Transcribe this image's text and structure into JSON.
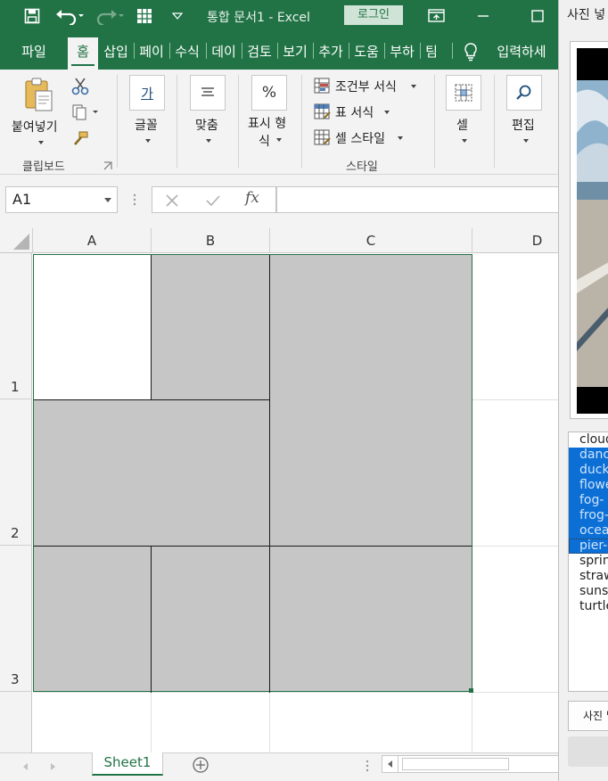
{
  "app": {
    "title": "통합 문서1 - Excel",
    "login_label": "로그인"
  },
  "tabs": [
    {
      "label": "파일"
    },
    {
      "label": "홈"
    },
    {
      "label": "삽입"
    },
    {
      "label": "페이"
    },
    {
      "label": "수식"
    },
    {
      "label": "데이"
    },
    {
      "label": "검토"
    },
    {
      "label": "보기"
    },
    {
      "label": "추가"
    },
    {
      "label": "도움"
    },
    {
      "label": "부하"
    },
    {
      "label": "팀"
    }
  ],
  "tell_me": "입력하세",
  "ribbon": {
    "paste_label": "붙여넣기",
    "clipboard_group": "클립보드",
    "font_label": "글꼴",
    "font_icon_text": "가",
    "align_label": "맞춤",
    "number_label_1": "표시 형",
    "number_label_2": "식",
    "number_icon_text": "%",
    "cond_format": "조건부 서식",
    "table_format": "표 서식",
    "cell_style": "셀 스타일",
    "styles_group": "스타일",
    "cells_label": "셀",
    "edit_label": "편집"
  },
  "formula_bar": {
    "name_box": "A1",
    "fx_label": "fx",
    "formula": ""
  },
  "grid": {
    "columns": [
      "A",
      "B",
      "C",
      "D"
    ],
    "rows": [
      "1",
      "2",
      "3"
    ]
  },
  "sheets": {
    "active": "Sheet1"
  },
  "dialog": {
    "title": "사진 넣",
    "files": [
      {
        "name": "cloud",
        "selected": false
      },
      {
        "name": "danc",
        "selected": true
      },
      {
        "name": "duck",
        "selected": true
      },
      {
        "name": "flowe",
        "selected": true
      },
      {
        "name": "fog-",
        "selected": true
      },
      {
        "name": "frog-",
        "selected": true
      },
      {
        "name": "ocea",
        "selected": true
      },
      {
        "name": "pier-",
        "selected": true
      },
      {
        "name": "sprin",
        "selected": false
      },
      {
        "name": "straw",
        "selected": false
      },
      {
        "name": "sunse",
        "selected": false
      },
      {
        "name": "turtle",
        "selected": false
      }
    ],
    "insert_button": "사진 넣"
  },
  "colors": {
    "excel_green": "#217346",
    "selection_blue": "#0b6fd6",
    "image_fill": "#c6c6c6"
  }
}
